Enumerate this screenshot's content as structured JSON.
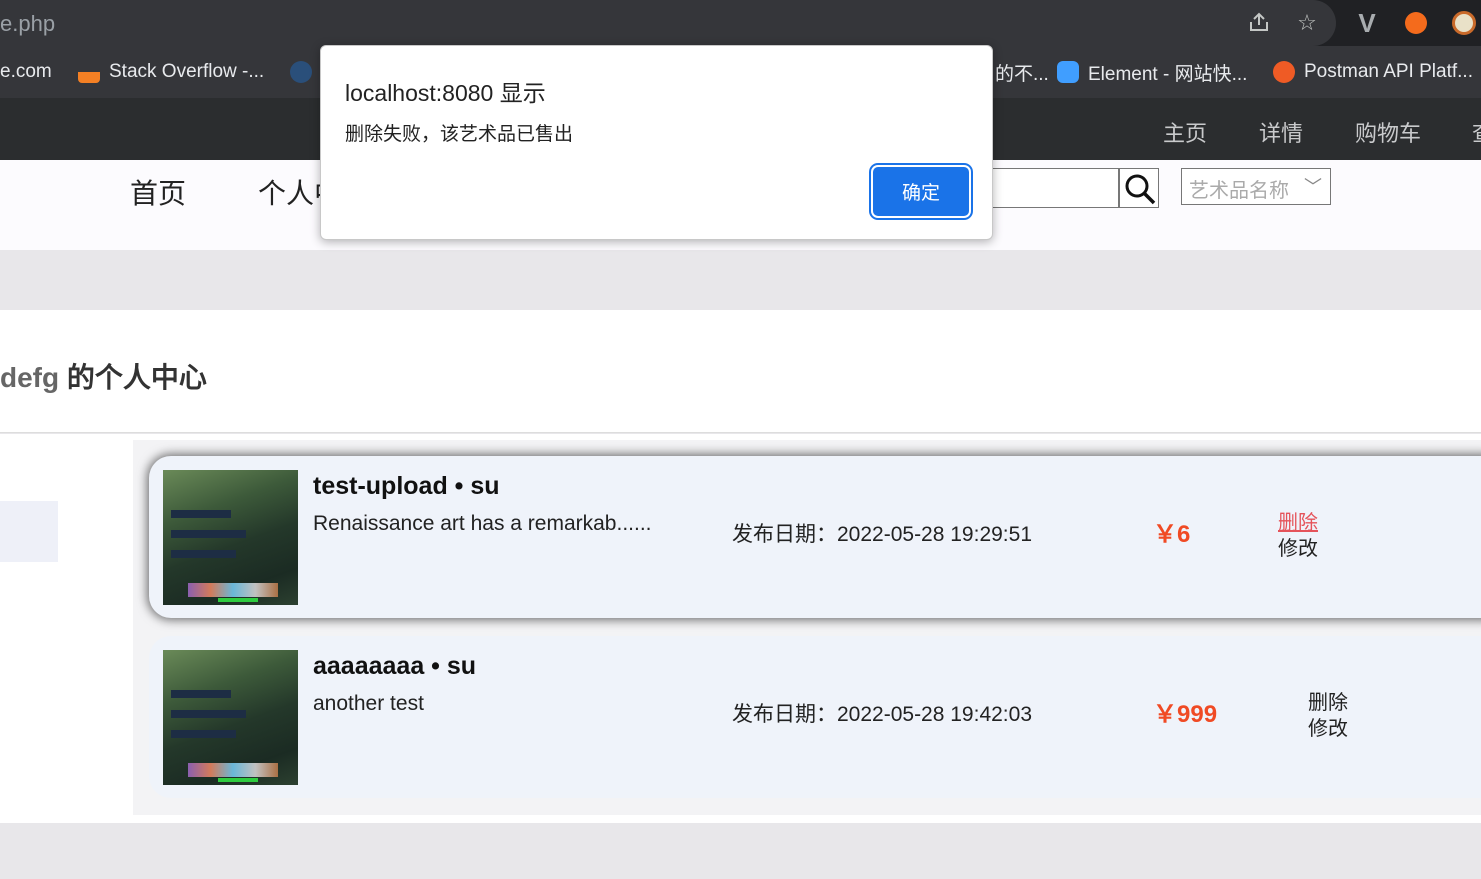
{
  "browser": {
    "url_fragment": "e.php",
    "bookmarks": [
      {
        "label": "e.com",
        "icon": "globe-icon"
      },
      {
        "label": "Stack Overflow -...",
        "icon": "stackoverflow-icon"
      },
      {
        "label": "...",
        "icon": "circle-icon"
      },
      {
        "label": "的不...",
        "icon": "bookmark-icon"
      },
      {
        "label": "Element - 网站快...",
        "icon": "element-icon"
      },
      {
        "label": "Postman API Platf...",
        "icon": "postman-icon"
      }
    ]
  },
  "site_top_nav": [
    "主页",
    "详情",
    "购物车",
    "查"
  ],
  "sub_nav": {
    "home": "首页",
    "personal": "个人中心",
    "category_select": "艺术品名称",
    "search_value": ""
  },
  "profile": {
    "username": "defg",
    "title_suffix": " 的个人中心"
  },
  "artworks": [
    {
      "title": "test-upload • su",
      "desc": "Renaissance art has a remarkab......",
      "date": "发布日期：2022-05-28 19:29:51",
      "price": "￥6",
      "delete": "删除",
      "edit": "修改"
    },
    {
      "title": "aaaaaaaa • su",
      "desc": "another test",
      "date": "发布日期：2022-05-28 19:42:03",
      "price": "￥999",
      "delete": "删除",
      "edit": "修改"
    }
  ],
  "dialog": {
    "title": "localhost:8080 显示",
    "message": "删除失败，该艺术品已售出",
    "ok": "确定"
  },
  "colors": {
    "price": "#f04a24",
    "dialog_button": "#1a73e8",
    "delete_hover": "#e5535a"
  }
}
